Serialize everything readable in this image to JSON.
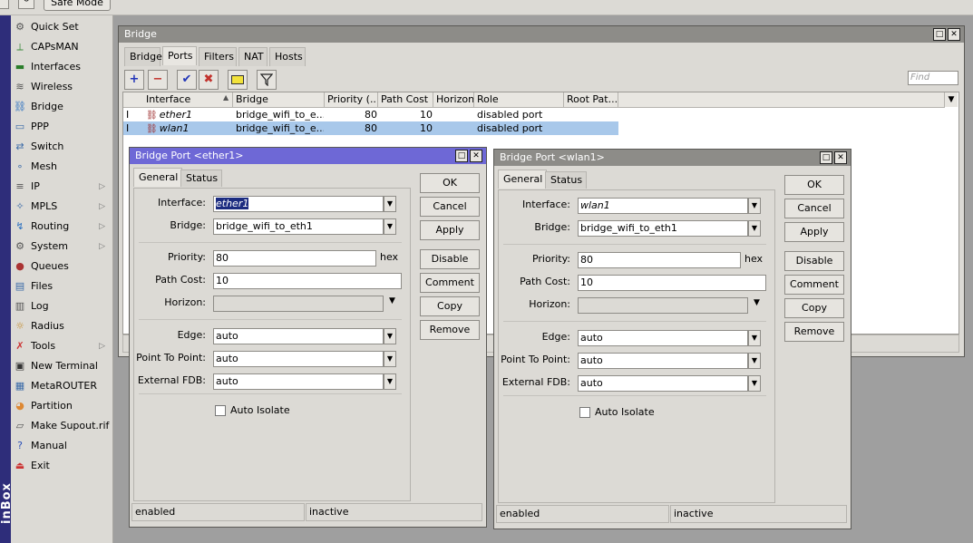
{
  "topbar": {
    "safe_mode": "Safe Mode"
  },
  "sidebar": {
    "brand": "inBox",
    "items": [
      {
        "label": "Quick Set",
        "icon": "quick-set-icon",
        "arrow": false
      },
      {
        "label": "CAPsMAN",
        "icon": "capsman-icon",
        "arrow": false
      },
      {
        "label": "Interfaces",
        "icon": "interfaces-icon",
        "arrow": false
      },
      {
        "label": "Wireless",
        "icon": "wireless-icon",
        "arrow": false
      },
      {
        "label": "Bridge",
        "icon": "bridge-icon",
        "arrow": false
      },
      {
        "label": "PPP",
        "icon": "ppp-icon",
        "arrow": false
      },
      {
        "label": "Switch",
        "icon": "switch-icon",
        "arrow": false
      },
      {
        "label": "Mesh",
        "icon": "mesh-icon",
        "arrow": false
      },
      {
        "label": "IP",
        "icon": "ip-icon",
        "arrow": true
      },
      {
        "label": "MPLS",
        "icon": "mpls-icon",
        "arrow": true
      },
      {
        "label": "Routing",
        "icon": "routing-icon",
        "arrow": true
      },
      {
        "label": "System",
        "icon": "system-icon",
        "arrow": true
      },
      {
        "label": "Queues",
        "icon": "queues-icon",
        "arrow": false
      },
      {
        "label": "Files",
        "icon": "files-icon",
        "arrow": false
      },
      {
        "label": "Log",
        "icon": "log-icon",
        "arrow": false
      },
      {
        "label": "Radius",
        "icon": "radius-icon",
        "arrow": false
      },
      {
        "label": "Tools",
        "icon": "tools-icon",
        "arrow": true
      },
      {
        "label": "New Terminal",
        "icon": "terminal-icon",
        "arrow": false
      },
      {
        "label": "MetaROUTER",
        "icon": "metarouter-icon",
        "arrow": false
      },
      {
        "label": "Partition",
        "icon": "partition-icon",
        "arrow": false
      },
      {
        "label": "Make Supout.rif",
        "icon": "supout-icon",
        "arrow": false
      },
      {
        "label": "Manual",
        "icon": "manual-icon",
        "arrow": false
      },
      {
        "label": "Exit",
        "icon": "exit-icon",
        "arrow": false
      }
    ]
  },
  "bridge_window": {
    "title": "Bridge",
    "tabs": [
      "Bridge",
      "Ports",
      "Filters",
      "NAT",
      "Hosts"
    ],
    "selected_tab": "Ports",
    "find_placeholder": "Find",
    "columns": [
      "Interface",
      "Bridge",
      "Priority (...",
      "Path Cost",
      "Horizon",
      "Role",
      "Root Pat..."
    ],
    "rows": [
      {
        "flag": "I",
        "interface": "ether1",
        "bridge": "bridge_wifi_to_e...",
        "priority": "80",
        "path_cost": "10",
        "horizon": "",
        "role": "disabled port",
        "root_path": ""
      },
      {
        "flag": "I",
        "interface": "wlan1",
        "bridge": "bridge_wifi_to_e...",
        "priority": "80",
        "path_cost": "10",
        "horizon": "",
        "role": "disabled port",
        "root_path": ""
      }
    ]
  },
  "dialogs": [
    {
      "title": "Bridge Port <ether1>",
      "tabs": [
        "General",
        "Status"
      ],
      "labels": {
        "interface": "Interface:",
        "bridge": "Bridge:",
        "priority": "Priority:",
        "path_cost": "Path Cost:",
        "horizon": "Horizon:",
        "edge": "Edge:",
        "p2p": "Point To Point:",
        "ext_fdb": "External FDB:",
        "auto_isolate": "Auto Isolate",
        "hex": "hex"
      },
      "values": {
        "interface": "ether1",
        "bridge": "bridge_wifi_to_eth1",
        "priority": "80",
        "path_cost": "10",
        "horizon": "",
        "edge": "auto",
        "p2p": "auto",
        "ext_fdb": "auto"
      },
      "buttons": [
        "OK",
        "Cancel",
        "Apply",
        "Disable",
        "Comment",
        "Copy",
        "Remove"
      ],
      "status": [
        "enabled",
        "inactive"
      ]
    },
    {
      "title": "Bridge Port <wlan1>",
      "tabs": [
        "General",
        "Status"
      ],
      "labels": {
        "interface": "Interface:",
        "bridge": "Bridge:",
        "priority": "Priority:",
        "path_cost": "Path Cost:",
        "horizon": "Horizon:",
        "edge": "Edge:",
        "p2p": "Point To Point:",
        "ext_fdb": "External FDB:",
        "auto_isolate": "Auto Isolate",
        "hex": "hex"
      },
      "values": {
        "interface": "wlan1",
        "bridge": "bridge_wifi_to_eth1",
        "priority": "80",
        "path_cost": "10",
        "horizon": "",
        "edge": "auto",
        "p2p": "auto",
        "ext_fdb": "auto"
      },
      "buttons": [
        "OK",
        "Cancel",
        "Apply",
        "Disable",
        "Comment",
        "Copy",
        "Remove"
      ],
      "status": [
        "enabled",
        "inactive"
      ]
    }
  ]
}
